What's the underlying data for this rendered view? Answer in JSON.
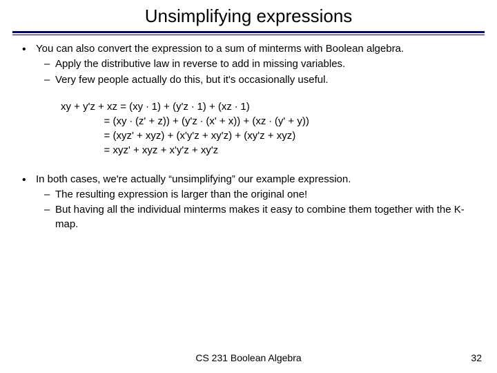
{
  "title": "Unsimplifying expressions",
  "bullets": {
    "b1": {
      "text": "You can also convert the expression to a sum of minterms with Boolean algebra.",
      "sub1": "Apply the distributive law in reverse to add in missing variables.",
      "sub2": "Very few people actually do this, but it's occasionally useful."
    },
    "b2": {
      "text": "In both cases, we're actually “unsimplifying” our example expression.",
      "sub1": "The resulting expression is larger than the original one!",
      "sub2": "But having all the individual minterms makes it easy to combine them together with the K-map."
    }
  },
  "equation": {
    "lhs": "xy + y'z + xz ",
    "r1": "= (xy ∙ 1) + (y'z ∙ 1) + (xz ∙ 1)",
    "r2": "= (xy ∙ (z' + z)) + (y'z ∙ (x' + x)) + (xz ∙ (y' + y))",
    "r3": "= (xyz' + xyz) + (x'y'z + xy'z) + (xy'z + xyz)",
    "r4": "= xyz' + xyz + x'y'z + xy'z"
  },
  "footer": {
    "center": "CS 231 Boolean Algebra",
    "page": "32"
  },
  "chart_data": null
}
